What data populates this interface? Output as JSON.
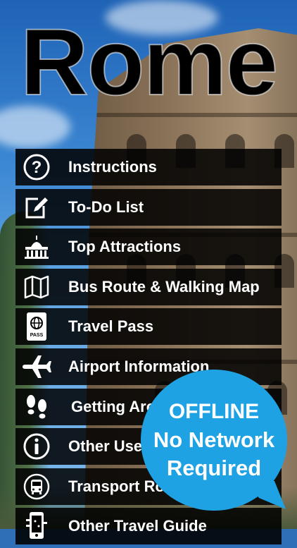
{
  "title": "Rome",
  "menu": {
    "items": [
      {
        "label": "Instructions",
        "icon": "question-circle-icon"
      },
      {
        "label": "To-Do List",
        "icon": "edit-note-icon"
      },
      {
        "label": "Top Attractions",
        "icon": "basilica-icon"
      },
      {
        "label": "Bus Route & Walking Map",
        "icon": "map-icon"
      },
      {
        "label": "Travel Pass",
        "icon": "passport-icon"
      },
      {
        "label": "Airport Information",
        "icon": "airplane-icon"
      },
      {
        "label": "Getting Around",
        "icon": "footprints-icon"
      },
      {
        "label": "Other Useful Info",
        "icon": "info-circle-icon"
      },
      {
        "label": "Transport Routes",
        "icon": "bus-icon"
      },
      {
        "label": "Other Travel Guide",
        "icon": "phone-guide-icon"
      }
    ]
  },
  "badge": {
    "line1": "OFFLINE",
    "line2": "No Network",
    "line3": "Required",
    "color": "#1ea2e3"
  }
}
